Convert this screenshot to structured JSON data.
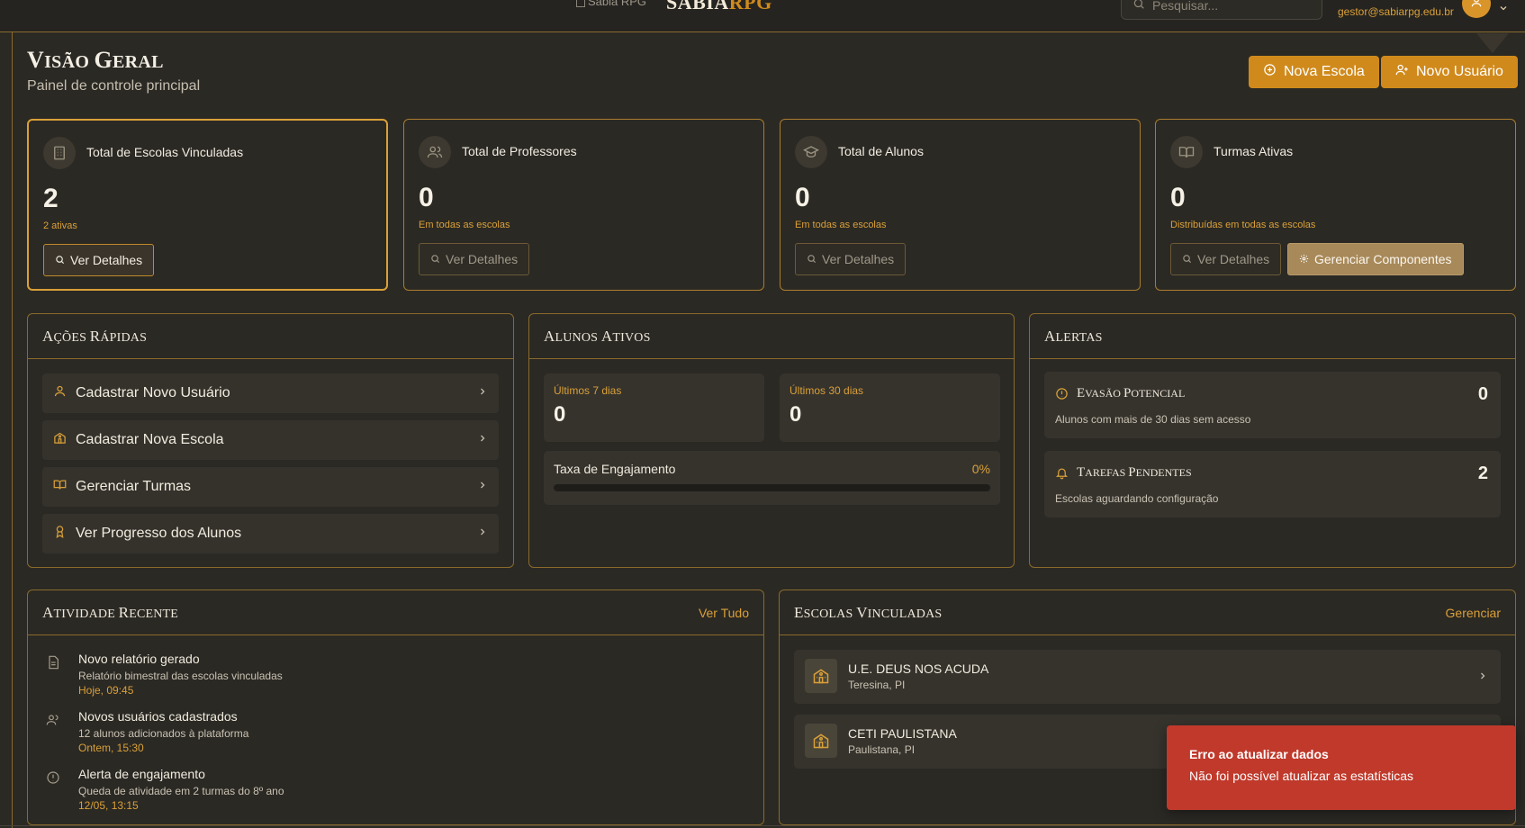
{
  "header": {
    "logo_alt": "Sabia RPG",
    "brand_part1": "SABIA",
    "brand_part2": "RPG",
    "search_placeholder": "Pesquisar...",
    "user_email": "gestor@sabiarpg.edu.br"
  },
  "page": {
    "title_first": "V",
    "title_rest": "ISÃO ",
    "title_second": "G",
    "title_second_rest": "ERAL",
    "subtitle": "Painel de controle principal",
    "btn_nova_escola": "Nova Escola",
    "btn_novo_usuario": "Novo Usuário"
  },
  "stats": [
    {
      "label": "Total de Escolas Vinculadas",
      "value": "2",
      "desc": "2 ativas",
      "button": "Ver Detalhes",
      "icon": "building-icon"
    },
    {
      "label": "Total de Professores",
      "value": "0",
      "desc": "Em todas as escolas",
      "button": "Ver Detalhes",
      "icon": "users-icon"
    },
    {
      "label": "Total de Alunos",
      "value": "0",
      "desc": "Em todas as escolas",
      "button": "Ver Detalhes",
      "icon": "graduation-cap-icon"
    },
    {
      "label": "Turmas Ativas",
      "value": "0",
      "desc": "Distribuídas em todas as escolas",
      "button": "Ver Detalhes",
      "button2": "Gerenciar Componentes",
      "icon": "book-open-icon"
    }
  ],
  "quick_actions": {
    "title_cap": "A",
    "title_rest": "ÇÕES ",
    "title_cap2": "R",
    "title_rest2": "ÁPIDAS",
    "items": [
      {
        "label": "Cadastrar Novo Usuário",
        "icon": "user-icon"
      },
      {
        "label": "Cadastrar Nova Escola",
        "icon": "school-icon"
      },
      {
        "label": "Gerenciar Turmas",
        "icon": "book-open-icon"
      },
      {
        "label": "Ver Progresso dos Alunos",
        "icon": "award-icon"
      }
    ]
  },
  "active_students": {
    "title_cap": "A",
    "title_rest": "LUNOS ",
    "title_cap2": "A",
    "title_rest2": "TIVOS",
    "last7_label": "Últimos 7 dias",
    "last7_value": "0",
    "last30_label": "Últimos 30 dias",
    "last30_value": "0",
    "engagement_label": "Taxa de Engajamento",
    "engagement_value": "0%",
    "engagement_fraction": 0
  },
  "alerts": {
    "title_cap": "A",
    "title_rest": "LERTAS",
    "items": [
      {
        "title_cap": "E",
        "title_rest": "VASÃO ",
        "title_cap2": "P",
        "title_rest2": "OTENCIAL",
        "desc": "Alunos com mais de 30 dias sem acesso",
        "count": "0",
        "icon": "alert-circle-icon"
      },
      {
        "title_cap": "T",
        "title_rest": "AREFAS ",
        "title_cap2": "P",
        "title_rest2": "ENDENTES",
        "desc": "Escolas aguardando configuração",
        "count": "2",
        "icon": "bell-icon"
      }
    ]
  },
  "recent_activity": {
    "title_cap": "A",
    "title_rest": "TIVIDADE ",
    "title_cap2": "R",
    "title_rest2": "ECENTE",
    "link": "Ver Tudo",
    "items": [
      {
        "title": "Novo relatório gerado",
        "desc": "Relatório bimestral das escolas vinculadas",
        "time": "Hoje, 09:45",
        "icon": "file-text-icon"
      },
      {
        "title": "Novos usuários cadastrados",
        "desc": "12 alunos adicionados à plataforma",
        "time": "Ontem, 15:30",
        "icon": "users-icon"
      },
      {
        "title": "Alerta de engajamento",
        "desc": "Queda de atividade em 2 turmas do 8º ano",
        "time": "12/05, 13:15",
        "icon": "alert-circle-icon"
      }
    ]
  },
  "linked_schools": {
    "title_cap": "E",
    "title_rest": "SCOLAS ",
    "title_cap2": "V",
    "title_rest2": "INCULADAS",
    "link": "Gerenciar",
    "items": [
      {
        "name": "U.E. DEUS NOS ACUDA",
        "city": "Teresina, PI"
      },
      {
        "name": "CETI PAULISTANA",
        "city": "Paulistana, PI"
      }
    ]
  },
  "toast": {
    "title": "Erro ao atualizar dados",
    "desc": "Não foi possível atualizar as estatísticas"
  },
  "colors": {
    "accent": "#d08a1c",
    "background": "#2b2924",
    "toast": "#c0392b"
  }
}
